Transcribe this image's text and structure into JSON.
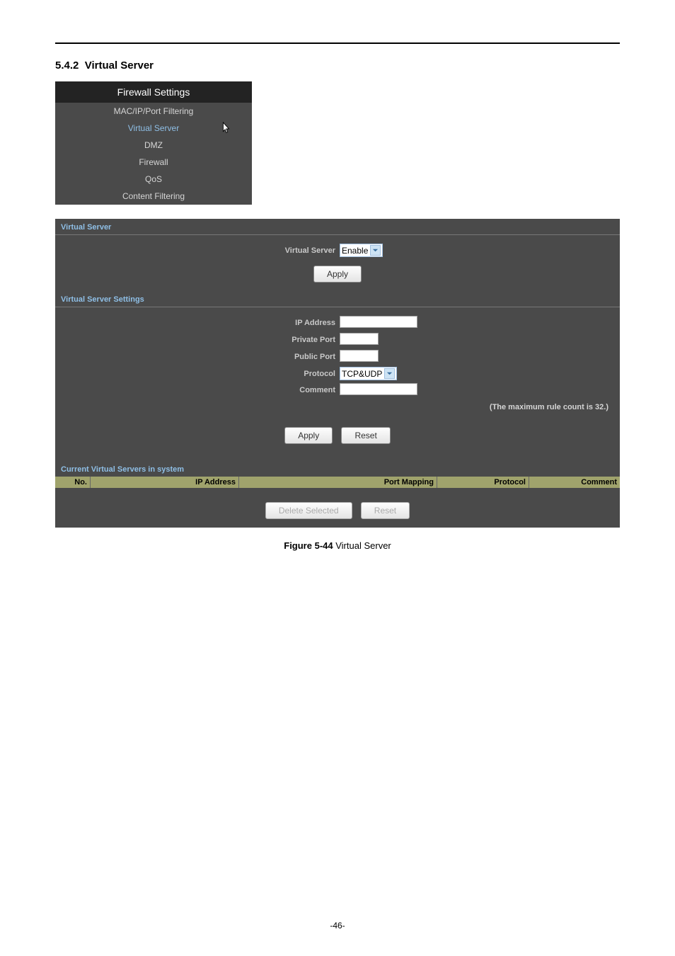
{
  "section_number": "5.4.2",
  "section_title": "Virtual Server",
  "sidebar": {
    "header": "Firewall Settings",
    "items": [
      {
        "label": "MAC/IP/Port Filtering",
        "selected": false
      },
      {
        "label": "Virtual Server",
        "selected": true
      },
      {
        "label": "DMZ",
        "selected": false
      },
      {
        "label": "Firewall",
        "selected": false
      },
      {
        "label": "QoS",
        "selected": false
      },
      {
        "label": "Content Filtering",
        "selected": false
      }
    ]
  },
  "panel1": {
    "title": "Virtual Server",
    "vs_label": "Virtual Server",
    "vs_value": "Enable",
    "apply_label": "Apply"
  },
  "panel2": {
    "title": "Virtual Server Settings",
    "ip_label": "IP Address",
    "private_port_label": "Private Port",
    "public_port_label": "Public Port",
    "protocol_label": "Protocol",
    "protocol_value": "TCP&UDP",
    "comment_label": "Comment",
    "note": "(The maximum rule count is 32.)",
    "apply_label": "Apply",
    "reset_label": "Reset"
  },
  "panel3": {
    "title": "Current Virtual Servers in system",
    "cols": {
      "no": "No.",
      "ip": "IP Address",
      "port": "Port Mapping",
      "protocol": "Protocol",
      "comment": "Comment"
    },
    "delete_label": "Delete Selected",
    "reset_label": "Reset"
  },
  "figure": {
    "label": "Figure 5-44",
    "caption": "Virtual Server"
  },
  "page_number": "-46-"
}
